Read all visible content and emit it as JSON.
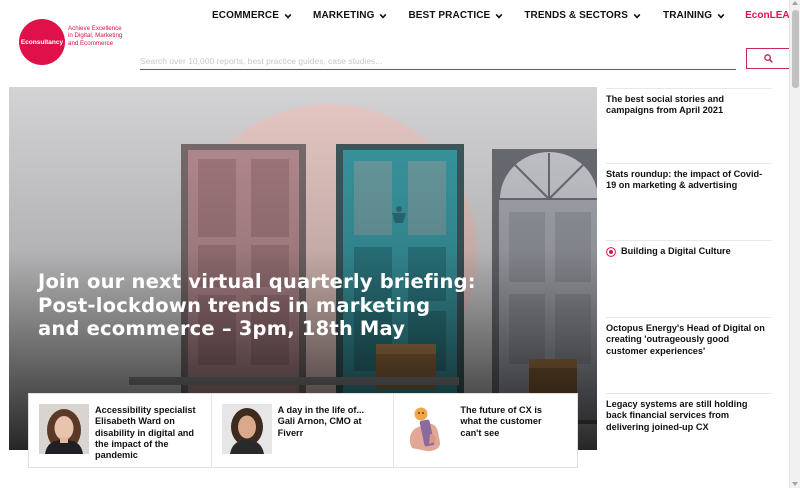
{
  "brand": {
    "logo_text": "Econsultancy",
    "tagline": "Achieve Excellence in Digital, Marketing and Ecommerce",
    "accent_color": "#e0114a"
  },
  "nav": {
    "items": [
      {
        "label": "ECOMMERCE",
        "icon": "chevron-down-icon"
      },
      {
        "label": "MARKETING",
        "icon": "chevron-down-icon"
      },
      {
        "label": "BEST PRACTICE",
        "icon": "chevron-down-icon"
      },
      {
        "label": "TRENDS & SECTORS",
        "icon": "chevron-down-icon"
      },
      {
        "label": "TRAINING",
        "icon": "chevron-down-icon"
      }
    ],
    "econlearn_label": "EconLEARN",
    "user_icon": "user-icon"
  },
  "search": {
    "placeholder": "Search over 10,000 reports, best practice guides, case studies...",
    "value": "",
    "button_icon": "search-icon"
  },
  "hero": {
    "title": "Join our next virtual quarterly briefing: Post-lockdown trends in marketing and ecommerce – 3pm, 18th May"
  },
  "cards": [
    {
      "title": "Accessibility specialist Elisabeth Ward on disability in digital and the impact of the pandemic"
    },
    {
      "title": "A day in the life of... Gali Arnon, CMO at Fiverr"
    },
    {
      "title": "The future of CX is what the customer can't see"
    }
  ],
  "sidebar": {
    "items": [
      {
        "title": "The best social stories and campaigns from April 2021"
      },
      {
        "title": "Stats roundup: the impact of Covid-19 on marketing & advertising"
      },
      {
        "title": "Building a Digital Culture",
        "icon": "record-icon"
      },
      {
        "title": "Octopus Energy's Head of Digital on creating 'outrageously good customer experiences'"
      },
      {
        "title": "Legacy systems are still holding back financial services from delivering joined-up CX"
      }
    ]
  }
}
